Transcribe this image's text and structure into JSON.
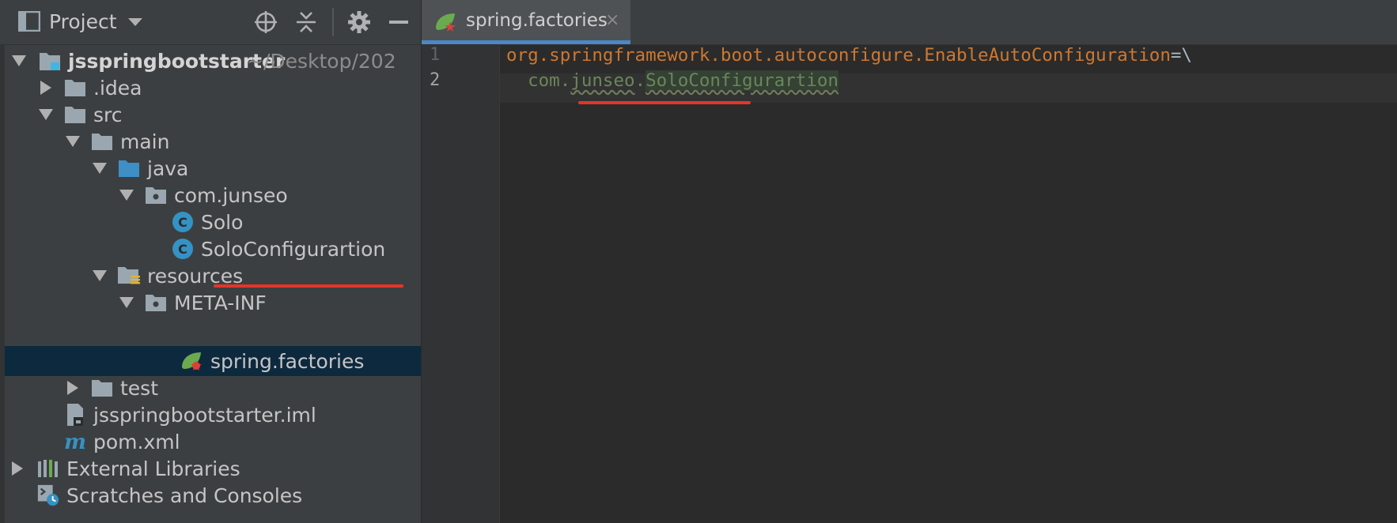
{
  "project_panel": {
    "title": "Project",
    "tree": [
      {
        "label": "jsspringbootstarter",
        "path": "~/Desktop/202",
        "bold": true
      },
      {
        "label": ".idea"
      },
      {
        "label": "src"
      },
      {
        "label": "main"
      },
      {
        "label": "java"
      },
      {
        "label": "com.junseo"
      },
      {
        "label": "Solo"
      },
      {
        "label": "SoloConfigurartion"
      },
      {
        "label": "resources"
      },
      {
        "label": "META-INF"
      },
      {
        "label": "spring.factories"
      },
      {
        "label": "test"
      },
      {
        "label": "jsspringbootstarter.iml"
      },
      {
        "label": "pom.xml"
      },
      {
        "label": "External Libraries"
      },
      {
        "label": "Scratches and Consoles"
      }
    ]
  },
  "editor": {
    "tab_label": "spring.factories",
    "tab_close": "×",
    "line_numbers": [
      "1",
      "2"
    ],
    "line1_key": "org.springframework.boot.autoconfigure.EnableAutoConfiguration",
    "line1_sep": "=\\",
    "line2_indent": "  ",
    "line2_pkg1": "com",
    "line2_dot1": ".",
    "line2_pkg2": "junseo",
    "line2_dot2": ".",
    "line2_class": "SoloConfigurartion"
  },
  "colors": {
    "accent": "#4a88c7",
    "highlight_underline": "#e5352a",
    "properties_key": "#cc7832",
    "properties_value": "#6a8759"
  },
  "icons": {
    "panel": "project-view-icon",
    "locate": "crosshair-icon",
    "collapse": "collapse-all-icon",
    "settings": "gear-icon",
    "hide": "minimize-icon"
  }
}
